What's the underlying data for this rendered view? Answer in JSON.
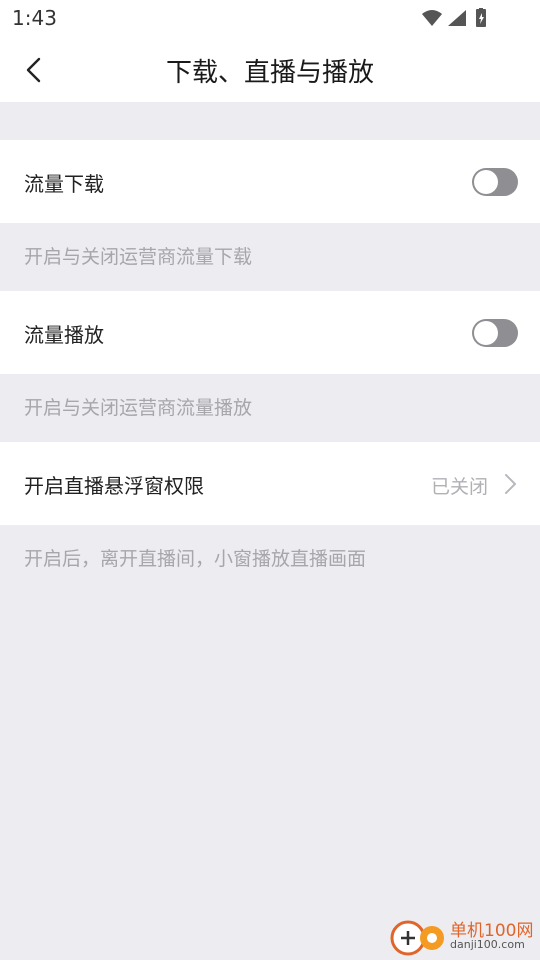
{
  "status_bar": {
    "time": "1:43",
    "icons": [
      "wifi-icon",
      "signal-icon",
      "battery-icon"
    ]
  },
  "header": {
    "title": "下载、直播与播放",
    "back_icon": "chevron-left-icon"
  },
  "settings": {
    "flow_download": {
      "label": "流量下载",
      "enabled": false,
      "description": "开启与关闭运营商流量下载"
    },
    "flow_playback": {
      "label": "流量播放",
      "enabled": false,
      "description": "开启与关闭运营商流量播放"
    },
    "live_floating_window": {
      "label": "开启直播悬浮窗权限",
      "value": "已关闭",
      "description": "开启后，离开直播间，小窗播放直播画面"
    }
  },
  "watermark": {
    "name": "单机100网",
    "url": "danji100.com"
  },
  "colors": {
    "toggle_off": "#8e8e93",
    "background": "#ededf1",
    "watermark": "#e0652a"
  }
}
